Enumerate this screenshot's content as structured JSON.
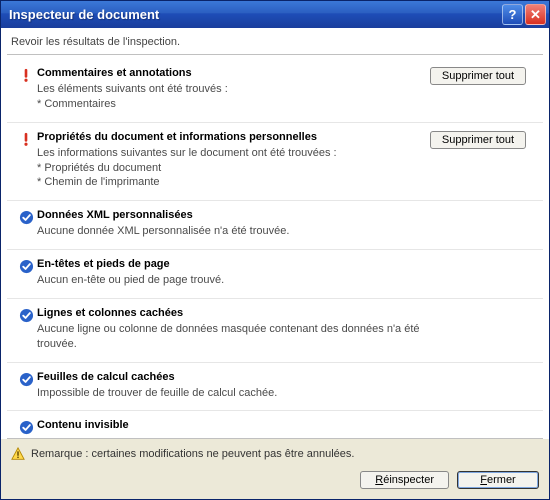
{
  "title": "Inspecteur de document",
  "subhead": "Revoir les résultats de l'inspection.",
  "buttons": {
    "remove_all": "Supprimer tout",
    "reinspect": "Réinspecter",
    "close": "Fermer",
    "help_icon": "?",
    "close_icon": "✕"
  },
  "items": [
    {
      "status": "alert",
      "title": "Commentaires et annotations",
      "desc": "Les éléments suivants ont été trouvés :\n* Commentaires",
      "action": true
    },
    {
      "status": "alert",
      "title": "Propriétés du document et informations personnelles",
      "desc": "Les informations suivantes sur le document ont été trouvées :\n* Propriétés du document\n* Chemin de l'imprimante",
      "action": true
    },
    {
      "status": "ok",
      "title": "Données XML personnalisées",
      "desc": "Aucune donnée XML personnalisée  n'a été trouvée.",
      "action": false
    },
    {
      "status": "ok",
      "title": "En-têtes et pieds de page",
      "desc": "Aucun en-tête ou pied de page trouvé.",
      "action": false
    },
    {
      "status": "ok",
      "title": "Lignes et colonnes cachées",
      "desc": "Aucune ligne ou colonne de données masquée contenant des données n'a été trouvée.",
      "action": false
    },
    {
      "status": "ok",
      "title": "Feuilles de calcul cachées",
      "desc": "Impossible de trouver de feuille de calcul cachée.",
      "action": false
    },
    {
      "status": "ok",
      "title": "Contenu invisible",
      "desc": "",
      "action": false
    }
  ],
  "note": "Remarque : certaines modifications ne peuvent pas être annulées."
}
